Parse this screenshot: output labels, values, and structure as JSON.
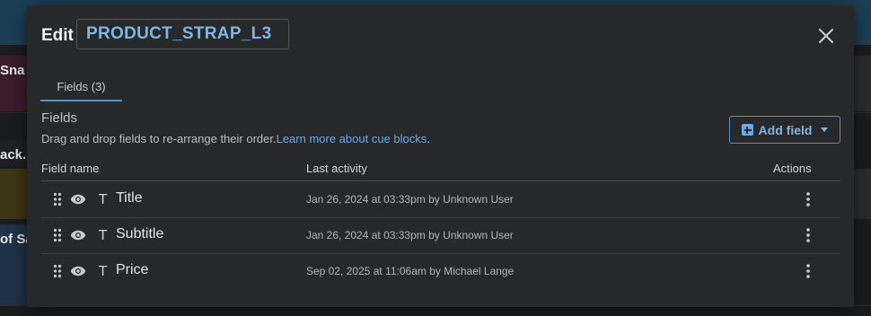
{
  "background": {
    "row_fragments": [
      "Sna",
      "ack. I",
      "",
      "of Sa"
    ]
  },
  "dialog": {
    "edit_label": "Edit",
    "name": "PRODUCT_STRAP_L3",
    "tab": "Fields (3)",
    "section_title": "Fields",
    "description": "Drag and drop fields to re-arrange their order.",
    "learn_more": "Learn more about cue blocks",
    "learn_more_suffix": ".",
    "add_field": "Add field",
    "columns": {
      "name": "Field name",
      "activity": "Last activity",
      "actions": "Actions"
    },
    "rows": [
      {
        "type_icon": "T",
        "name": "Title",
        "activity": "Jan 26, 2024 at 03:33pm by Unknown User"
      },
      {
        "type_icon": "T",
        "name": "Subtitle",
        "activity": "Jan 26, 2024 at 03:33pm by Unknown User"
      },
      {
        "type_icon": "T",
        "name": "Price",
        "activity": "Sep 02, 2025 at 11:06am by Michael Lange"
      }
    ]
  },
  "colors": {
    "accent": "#4b92d0",
    "link": "#6aa9e0",
    "dialog_bg": "#27282a"
  }
}
